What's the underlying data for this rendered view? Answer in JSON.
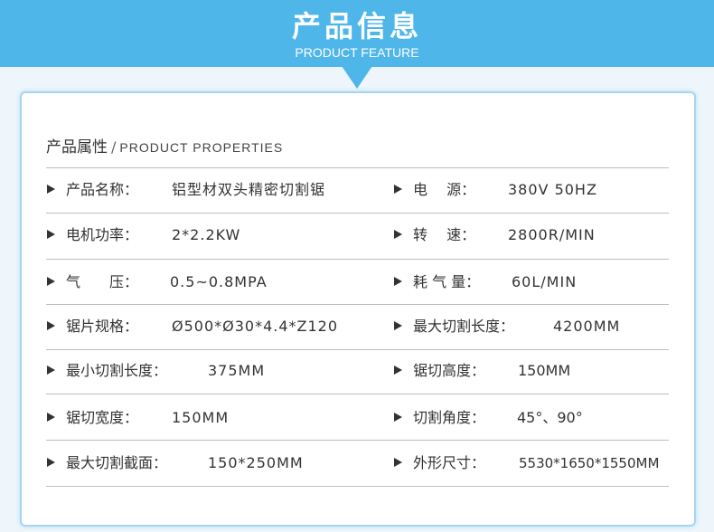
{
  "banner": {
    "title": "产品信息",
    "subtitle": "PRODUCT FEATURE"
  },
  "section": {
    "title_cn": "产品属性",
    "separator": "/",
    "title_en": "PRODUCT PROPERTIES"
  },
  "rows": [
    {
      "left": {
        "label": "产品名称：",
        "value": "铝型材双头精密切割锯"
      },
      "right": {
        "label": "电　  源：",
        "value": "380V 50HZ"
      }
    },
    {
      "left": {
        "label": "电机功率：",
        "value": "2*2.2KW"
      },
      "right": {
        "label": "转　  速：",
        "value": "2800R/MIN"
      }
    },
    {
      "left": {
        "label": "气　　压：",
        "value": "0.5~0.8MPA"
      },
      "right": {
        "label": "耗 气 量：",
        "value": "60L/MIN"
      }
    },
    {
      "left": {
        "label": "锯片规格：",
        "value": "Ø500*Ø30*4.4*Z120"
      },
      "right": {
        "label": "最大切割长度：",
        "value": "4200MM"
      }
    },
    {
      "left": {
        "label": "最小切割长度：",
        "value": "375MM"
      },
      "right": {
        "label": "锯切高度：",
        "value": "150MM"
      }
    },
    {
      "left": {
        "label": "锯切宽度：",
        "value": "150MM"
      },
      "right": {
        "label": "切割角度：",
        "value": "45°、90°"
      }
    },
    {
      "left": {
        "label": "最大切割截面：",
        "value": "150*250MM"
      },
      "right": {
        "label": "外形尺寸：",
        "value": "5530*1650*1550MM"
      }
    }
  ],
  "colors": {
    "accent": "#4fb6ea",
    "text": "#333333",
    "divider": "#bdbdbd"
  }
}
